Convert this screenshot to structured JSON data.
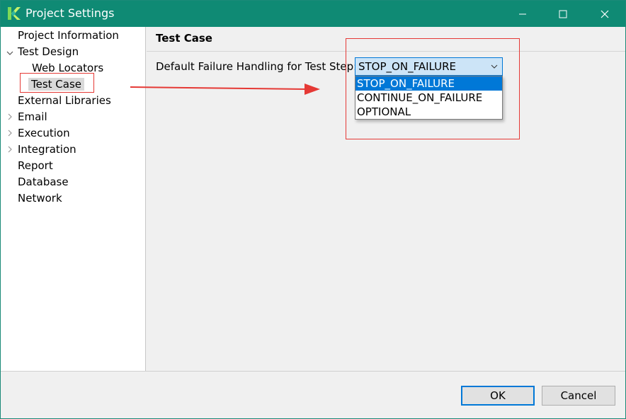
{
  "window": {
    "title": "Project Settings",
    "icon": "katalon-k-logo",
    "controls": [
      "minimize-icon",
      "maximize-icon",
      "close-icon"
    ]
  },
  "sidebar": {
    "items": [
      {
        "label": "Project Information",
        "expander": "none"
      },
      {
        "label": "Test Design",
        "expander": "expanded"
      },
      {
        "label": "Web Locators",
        "expander": "none",
        "level": 2
      },
      {
        "label": "Test Case",
        "expander": "none",
        "level": 2,
        "selected": true
      },
      {
        "label": "External Libraries",
        "expander": "none"
      },
      {
        "label": "Email",
        "expander": "collapsed"
      },
      {
        "label": "Execution",
        "expander": "collapsed"
      },
      {
        "label": "Integration",
        "expander": "collapsed"
      },
      {
        "label": "Report",
        "expander": "none"
      },
      {
        "label": "Database",
        "expander": "none"
      },
      {
        "label": "Network",
        "expander": "none"
      }
    ]
  },
  "main": {
    "section_title": "Test Case",
    "field_label": "Default Failure Handling for Test Step:",
    "combo": {
      "selected_value": "STOP_ON_FAILURE",
      "options": [
        "STOP_ON_FAILURE",
        "CONTINUE_ON_FAILURE",
        "OPTIONAL"
      ]
    }
  },
  "footer": {
    "ok_label": "OK",
    "cancel_label": "Cancel"
  },
  "colors": {
    "titlebar": "#0f8a74",
    "accent": "#0078d7",
    "annotation": "#e53935"
  }
}
